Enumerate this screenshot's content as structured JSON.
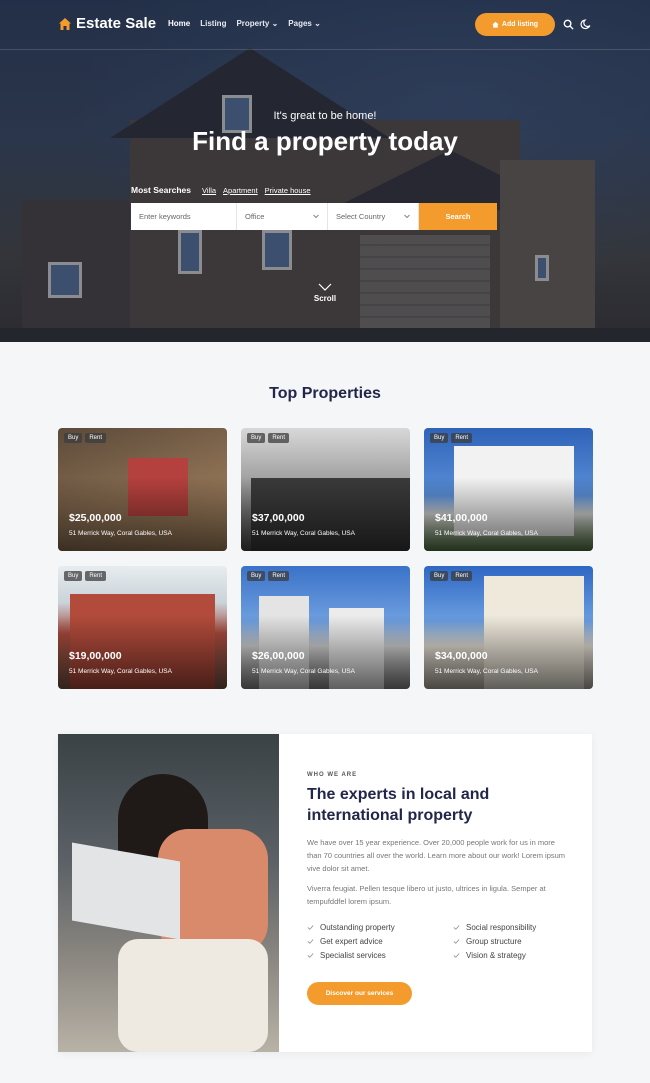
{
  "brand": {
    "name": "Estate Sale",
    "icon": "home-icon",
    "accent": "#f39c2d"
  },
  "nav": {
    "items": [
      {
        "label": "Home",
        "active": true
      },
      {
        "label": "Listing"
      },
      {
        "label": "Property ⌄"
      },
      {
        "label": "Pages ⌄"
      }
    ],
    "add_listing": "Add listing"
  },
  "hero": {
    "subtitle": "It's great to be home!",
    "title": "Find a property today",
    "most_searches_label": "Most Searches",
    "most_searches": [
      "Villa",
      "Apartment",
      "Private house"
    ],
    "search": {
      "keywords_placeholder": "Enter keywords",
      "type_value": "Office",
      "country_placeholder": "Select Country",
      "button": "Search"
    },
    "scroll": "Scroll"
  },
  "top_properties": {
    "title": "Top Properties",
    "cards": [
      {
        "tags": [
          "Buy",
          "Rent"
        ],
        "price": "$25,00,000",
        "address": "51 Merrick Way, Coral Gables, USA"
      },
      {
        "tags": [
          "Buy",
          "Rent"
        ],
        "price": "$37,00,000",
        "address": "51 Merrick Way, Coral Gables, USA"
      },
      {
        "tags": [
          "Buy",
          "Rent"
        ],
        "price": "$41,00,000",
        "address": "51 Merrick Way, Coral Gables, USA"
      },
      {
        "tags": [
          "Buy",
          "Rent"
        ],
        "price": "$19,00,000",
        "address": "51 Merrick Way, Coral Gables, USA"
      },
      {
        "tags": [
          "Buy",
          "Rent"
        ],
        "price": "$26,00,000",
        "address": "51 Merrick Way, Coral Gables, USA"
      },
      {
        "tags": [
          "Buy",
          "Rent"
        ],
        "price": "$34,00,000",
        "address": "51 Merrick Way, Coral Gables, USA"
      }
    ]
  },
  "about": {
    "eyebrow": "WHO WE ARE",
    "title": "The experts in local and international property",
    "para1": "We have over 15 year experience. Over 20,000 people work for us in more than 70 countries all over the world. Learn more about our work! Lorem ipsum vive dolor sit amet.",
    "para2": "Viverra feugiat. Pellen tesque libero ut justo, ultrices in ligula. Semper at tempufddfel lorem ipsum.",
    "features": [
      "Outstanding property",
      "Social responsibility",
      "Get expert advice",
      "Group structure",
      "Specialist services",
      "Vision & strategy"
    ],
    "button": "Discover our services"
  }
}
